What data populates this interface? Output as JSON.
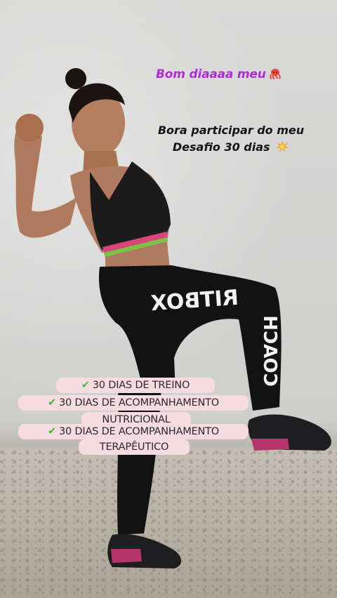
{
  "story": {
    "greeting": "Bom diaaaa meu",
    "greeting_emoji": "octopus-icon",
    "invite_line1": "Bora participar do meu",
    "invite_line2": "Desafio 30 dias",
    "invite_emoji": "sparkle-burst-icon",
    "checklist": [
      "30 DIAS DE TREINO",
      "30 DIAS DE ACOMPANHAMENTO",
      "NUTRICIONAL",
      "30 DIAS DE ACOMPANHAMENTO",
      "TERAPÊUTICO"
    ],
    "check_icon": "check-mark-icon",
    "leggings_text": "RITBOX",
    "leggings_text2": "COACH"
  },
  "colors": {
    "greeting": "#b02bd6",
    "pill_bg": "#f6dbe2",
    "check": "#3bbf2f"
  }
}
